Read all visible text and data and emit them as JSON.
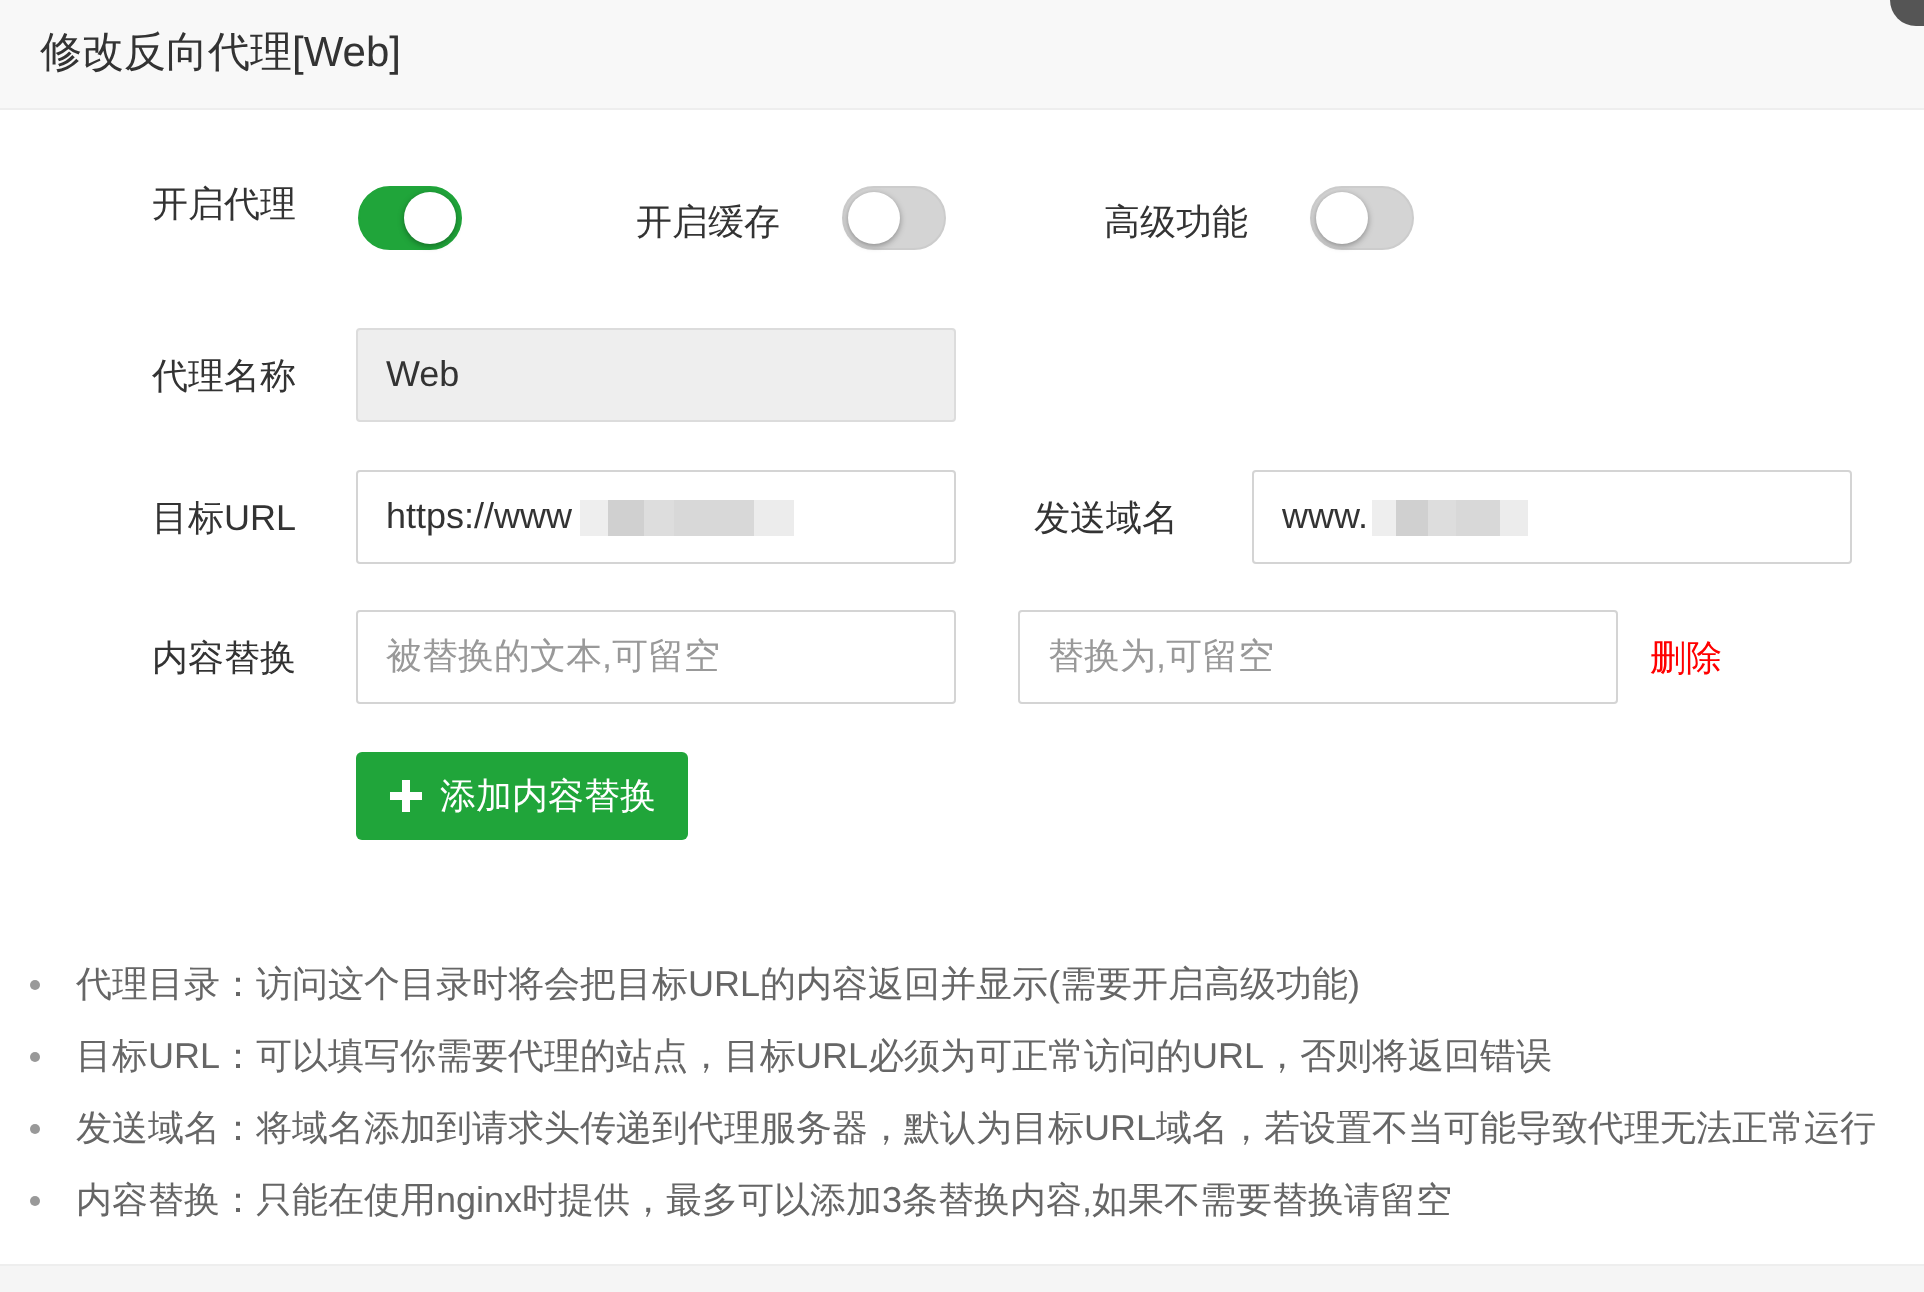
{
  "dialog": {
    "title": "修改反向代理[Web]"
  },
  "toggles": [
    {
      "label": "开启代理",
      "on": true
    },
    {
      "label": "开启缓存",
      "on": false
    },
    {
      "label": "高级功能",
      "on": false
    }
  ],
  "proxy_name": {
    "label": "代理名称",
    "value": "Web",
    "disabled": true
  },
  "target_url": {
    "label": "目标URL",
    "value": "https://www"
  },
  "send_domain": {
    "label": "发送域名",
    "value": "www."
  },
  "content_replace": {
    "label": "内容替换",
    "rows": [
      {
        "find": {
          "placeholder": "被替换的文本,可留空"
        },
        "replace": {
          "placeholder": "替换为,可留空"
        },
        "delete": "删除"
      }
    ],
    "add_button": "添加内容替换"
  },
  "notes": [
    "代理目录：访问这个目录时将会把目标URL的内容返回并显示(需要开启高级功能)",
    "目标URL：可以填写你需要代理的站点，目标URL必须为可正常访问的URL，否则将返回错误",
    "发送域名：将域名添加到请求头传递到代理服务器，默认为目标URL域名，若设置不当可能导致代理无法正常运行",
    "内容替换：只能在使用nginx时提供，最多可以添加3条替换内容,如果不需要替换请留空"
  ]
}
